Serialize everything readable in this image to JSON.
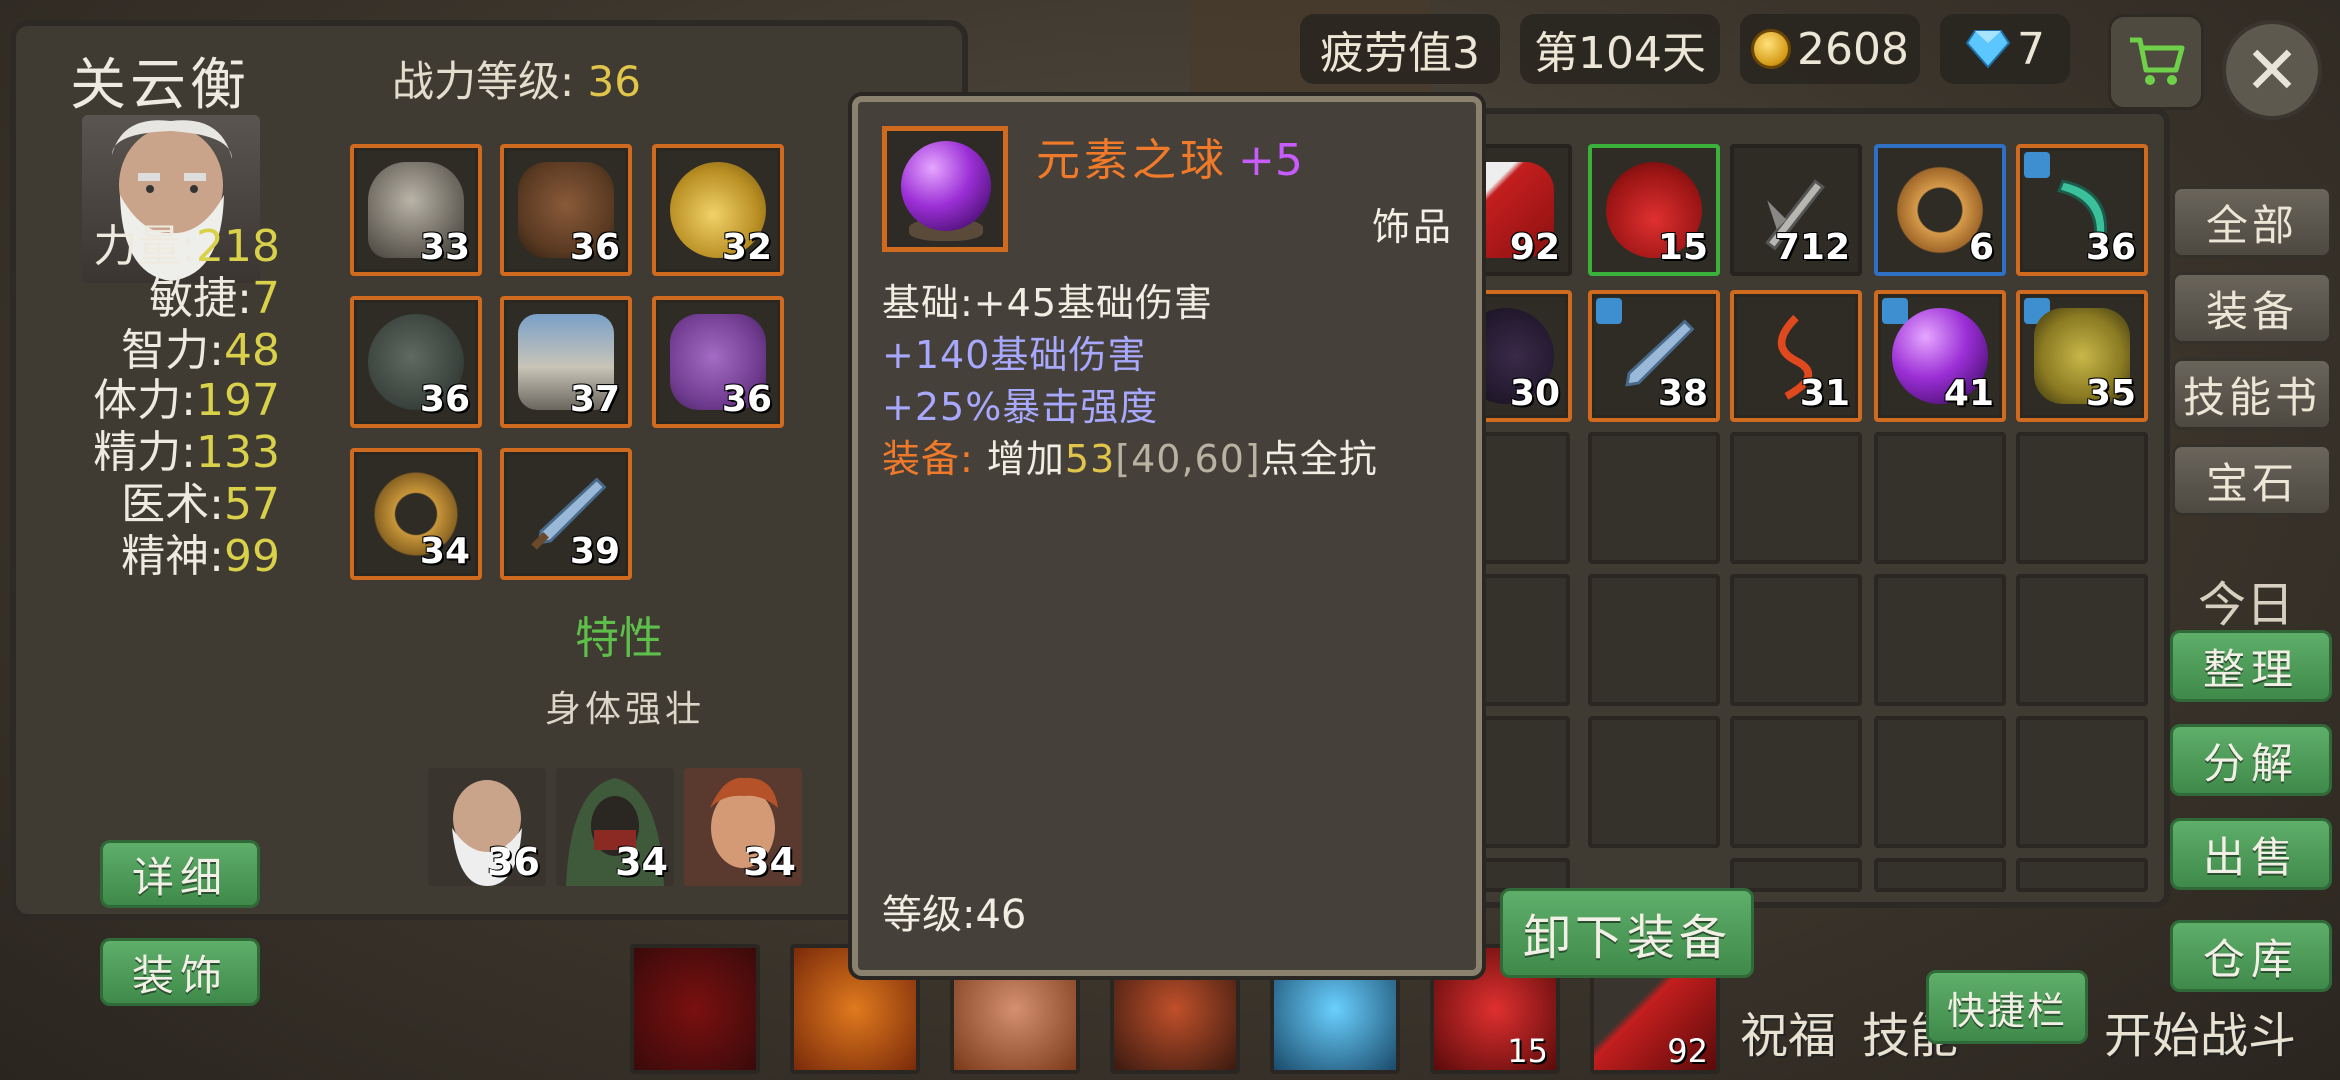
{
  "hud": {
    "fatigue": "疲劳值3",
    "day": "第104天",
    "gold": "2608",
    "diamonds": "7"
  },
  "character": {
    "name": "关云衡",
    "power_label": "战力等级:",
    "power_value": "36",
    "stats": [
      {
        "label": "力量:",
        "value": "218"
      },
      {
        "label": "敏捷:",
        "value": "7"
      },
      {
        "label": "智力:",
        "value": "48"
      },
      {
        "label": "体力:",
        "value": "197"
      },
      {
        "label": "精力:",
        "value": "133"
      },
      {
        "label": "医术:",
        "value": "57"
      },
      {
        "label": "精神:",
        "value": "99"
      }
    ],
    "detail_button": "详细",
    "decor_button": "装饰",
    "trait_title": "特性",
    "trait_text": "身体强壮",
    "equipment_levels": [
      "33",
      "36",
      "32",
      "36",
      "37",
      "36",
      "34",
      "39"
    ],
    "allies": [
      "36",
      "34",
      "34"
    ]
  },
  "inventory": {
    "row1_levels": [
      "92",
      "15",
      "712",
      "6",
      "36"
    ],
    "row2_levels": [
      "30",
      "38",
      "31",
      "41",
      "35"
    ],
    "tabs": [
      "全部",
      "装备",
      "技能书",
      "宝石"
    ],
    "today_label": "今日",
    "actions": [
      "整理",
      "分解",
      "出售",
      "仓库"
    ]
  },
  "tooltip": {
    "name": "元素之球",
    "enhance": "+5",
    "type": "饰品",
    "base": "基础:+45基础伤害",
    "bonus1": "+140基础伤害",
    "bonus2": "+25%暴击强度",
    "equip_label": "装备:",
    "equip_pre": " 增加",
    "equip_num": "53",
    "equip_range": "[40,60]",
    "equip_post": "点全抗",
    "level": "等级:46",
    "unequip_button": "卸下装备"
  },
  "skillbar": {
    "counts": [
      "15",
      "92"
    ],
    "bottom_text_1": "祝福",
    "bottom_text_2": "技能",
    "bottom_text_3": "开始战斗",
    "quickbar_button": "快捷栏"
  }
}
